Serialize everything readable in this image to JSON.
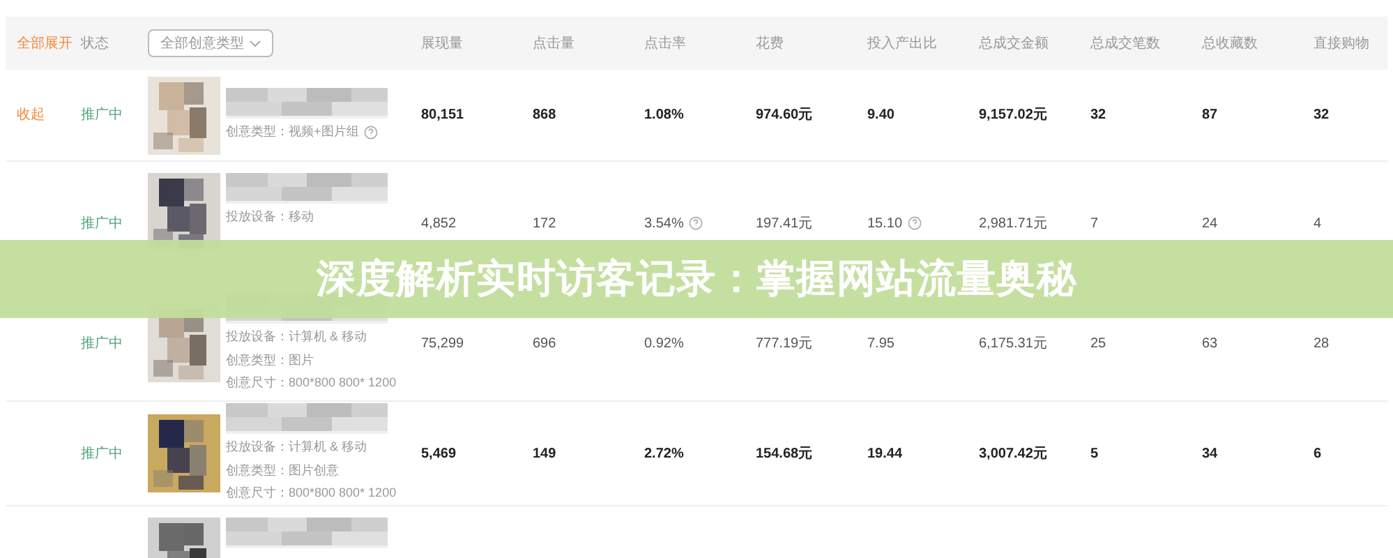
{
  "table": {
    "header": [
      {
        "kind": "link",
        "text": "全部展开"
      },
      {
        "kind": "label",
        "text": "状态"
      },
      {
        "kind": "dropdown",
        "text": "全部创意类型"
      },
      {
        "kind": "label",
        "text": "展现量"
      },
      {
        "kind": "label",
        "text": "点击量"
      },
      {
        "kind": "label",
        "text": "点击率"
      },
      {
        "kind": "label",
        "text": "花费"
      },
      {
        "kind": "label",
        "text": "投入产出比"
      },
      {
        "kind": "label",
        "text": "总成交金额"
      },
      {
        "kind": "label",
        "text": "总成交笔数"
      },
      {
        "kind": "label",
        "text": "总收藏数"
      },
      {
        "kind": "label",
        "text": "直接购物"
      }
    ],
    "rows": [
      {
        "toggle": "收起",
        "status": "推广中",
        "bold": true,
        "details": [
          {
            "text": "创意类型：视频+图片组",
            "help": true
          }
        ],
        "values": [
          {
            "text": "80,151",
            "help": false
          },
          {
            "text": "868",
            "help": false
          },
          {
            "text": "1.08%",
            "help": false
          },
          {
            "text": "974.60元",
            "help": false
          },
          {
            "text": "9.40",
            "help": false
          },
          {
            "text": "9,157.02元",
            "help": false
          },
          {
            "text": "32",
            "help": false
          },
          {
            "text": "87",
            "help": false
          },
          {
            "text": "32",
            "help": false
          }
        ]
      },
      {
        "status": "推广中",
        "bold": false,
        "details": [
          {
            "text": "投放设备：移动",
            "help": false
          }
        ],
        "values": [
          {
            "text": "4,852",
            "help": false
          },
          {
            "text": "172",
            "help": false
          },
          {
            "text": "3.54%",
            "help": true
          },
          {
            "text": "197.41元",
            "help": false
          },
          {
            "text": "15.10",
            "help": true
          },
          {
            "text": "2,981.71元",
            "help": false
          },
          {
            "text": "7",
            "help": false
          },
          {
            "text": "24",
            "help": false
          },
          {
            "text": "4",
            "help": false
          }
        ]
      },
      {
        "status": "推广中",
        "bold": false,
        "details": [
          {
            "text": "投放设备：计算机 & 移动",
            "help": false
          },
          {
            "text": "创意类型：图片",
            "help": false
          },
          {
            "text": "创意尺寸：800*800 800* 1200",
            "help": false
          }
        ],
        "values": [
          {
            "text": "75,299",
            "help": false
          },
          {
            "text": "696",
            "help": false
          },
          {
            "text": "0.92%",
            "help": false
          },
          {
            "text": "777.19元",
            "help": false
          },
          {
            "text": "7.95",
            "help": false
          },
          {
            "text": "6,175.31元",
            "help": false
          },
          {
            "text": "25",
            "help": false
          },
          {
            "text": "63",
            "help": false
          },
          {
            "text": "28",
            "help": false
          }
        ]
      },
      {
        "status": "推广中",
        "bold": true,
        "details": [
          {
            "text": "投放设备：计算机 & 移动",
            "help": false
          },
          {
            "text": "创意类型：图片创意",
            "help": false
          },
          {
            "text": "创意尺寸：800*800 800* 1200",
            "help": false
          }
        ],
        "values": [
          {
            "text": "5,469",
            "help": false
          },
          {
            "text": "149",
            "help": false
          },
          {
            "text": "2.72%",
            "help": false
          },
          {
            "text": "154.68元",
            "help": false
          },
          {
            "text": "19.44",
            "help": false
          },
          {
            "text": "3,007.42元",
            "help": false
          },
          {
            "text": "5",
            "help": false
          },
          {
            "text": "34",
            "help": false
          },
          {
            "text": "6",
            "help": false
          }
        ]
      }
    ]
  },
  "banner": {
    "title": "深度解析实时访客记录：掌握网站流量奥秘"
  }
}
